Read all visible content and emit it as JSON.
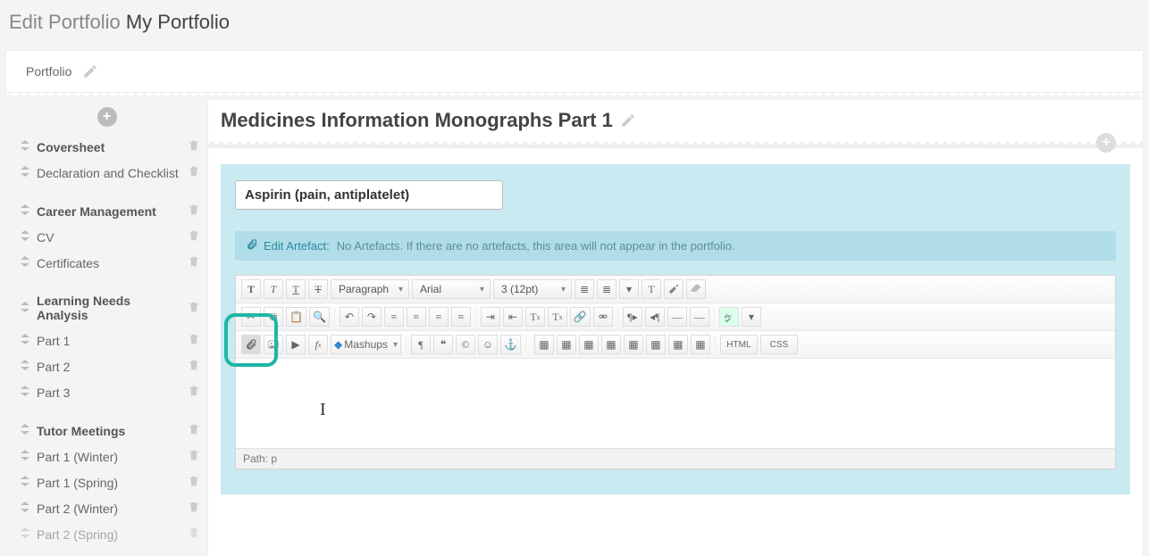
{
  "header": {
    "prefix": "Edit Portfolio",
    "title": "My Portfolio"
  },
  "tab": {
    "label": "Portfolio"
  },
  "sidebar": {
    "groups": [
      {
        "header": null,
        "items": [
          {
            "label": "Coversheet",
            "bold": true
          },
          {
            "label": "Declaration and Checklist",
            "bold": false
          }
        ]
      },
      {
        "header": null,
        "items": [
          {
            "label": "Career Management",
            "bold": true
          },
          {
            "label": "CV",
            "bold": false
          },
          {
            "label": "Certificates",
            "bold": false
          }
        ]
      },
      {
        "header": null,
        "items": [
          {
            "label": "Learning Needs Analysis",
            "bold": true
          },
          {
            "label": "Part 1",
            "bold": false
          },
          {
            "label": "Part 2",
            "bold": false
          },
          {
            "label": "Part 3",
            "bold": false
          }
        ]
      },
      {
        "header": null,
        "items": [
          {
            "label": "Tutor Meetings",
            "bold": true
          },
          {
            "label": "Part 1 (Winter)",
            "bold": false
          },
          {
            "label": "Part 1 (Spring)",
            "bold": false
          },
          {
            "label": "Part 2 (Winter)",
            "bold": false
          },
          {
            "label": "Part 2 (Spring)",
            "bold": false
          }
        ]
      }
    ]
  },
  "content": {
    "title": "Medicines Information Monographs Part 1",
    "artifact_title": "Aspirin (pain, antiplatelet)",
    "artefact_bar": {
      "link": "Edit Artefact:",
      "message": "No Artefacts. If there are no artefacts, this area will not appear in the portfolio."
    },
    "editor": {
      "para_select": "Paragraph",
      "font_select": "Arial",
      "size_select": "3 (12pt)",
      "mashups_label": "Mashups",
      "html_label": "HTML",
      "css_label": "CSS",
      "path_label": "Path:",
      "path_value": "p"
    }
  }
}
